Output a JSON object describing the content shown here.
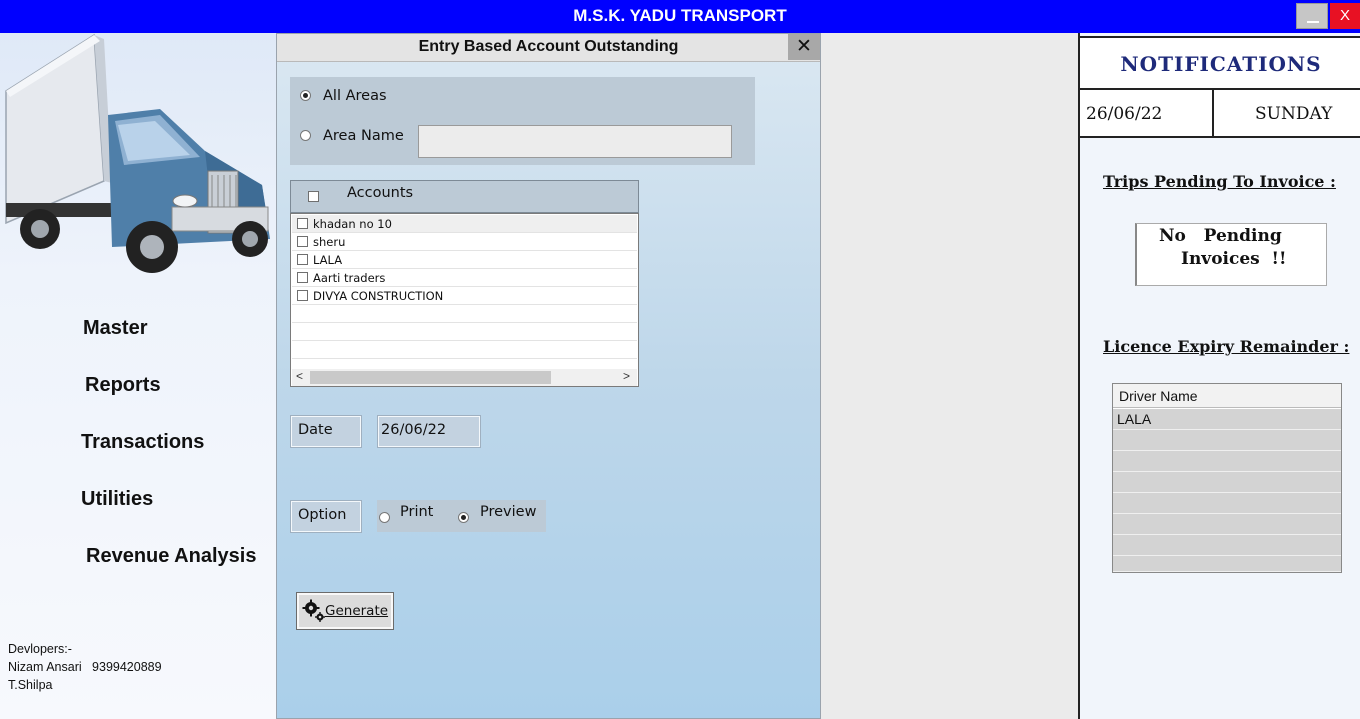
{
  "window": {
    "title": "M.S.K. YADU TRANSPORT",
    "close_glyph": "X"
  },
  "sidebar": {
    "menu": [
      "Master",
      "Reports",
      "Transactions",
      "Utilities",
      "Revenue Analysis"
    ],
    "developers_label": "Devlopers:-",
    "developers": [
      "Nizam Ansari   9399420889",
      "T.Shilpa"
    ]
  },
  "dialog": {
    "title": "Entry Based Account Outstanding",
    "close_glyph": "✕",
    "area": {
      "all_label": "All Areas",
      "name_label": "Area Name",
      "name_value": "",
      "selected": "All Areas"
    },
    "accounts": {
      "header": "Accounts",
      "items": [
        {
          "name": "khadan no 10",
          "checked": false
        },
        {
          "name": "sheru",
          "checked": false
        },
        {
          "name": "LALA",
          "checked": false
        },
        {
          "name": "Aarti traders",
          "checked": false
        },
        {
          "name": "DIVYA CONSTRUCTION",
          "checked": false
        }
      ],
      "scroll_left": "<",
      "scroll_right": ">"
    },
    "date_label": "Date",
    "date_value": "26/06/22",
    "option_label": "Option",
    "options": [
      "Print",
      "Preview"
    ],
    "option_selected": "Preview",
    "generate_label": "Generate"
  },
  "notifications": {
    "title": "NOTIFICATIONS",
    "date": "26/06/22",
    "day": "SUNDAY",
    "trips_heading": "Trips Pending To Invoice :",
    "pending_line1": "No   Pending",
    "pending_line2": "Invoices  !!",
    "licence_heading": "Licence Expiry Remainder :",
    "driver_header": "Driver Name",
    "drivers": [
      "LALA",
      "",
      "",
      "",
      "",
      "",
      "",
      ""
    ]
  },
  "colors": {
    "titlebar": "#0000ff",
    "close": "#e81123",
    "notif_title": "#1e2a7a"
  }
}
